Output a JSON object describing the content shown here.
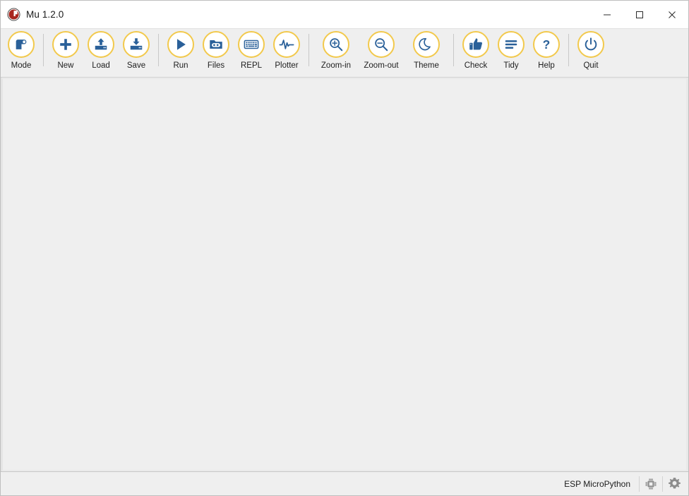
{
  "window": {
    "title": "Mu 1.2.0",
    "logo_icon": "mu-logo-icon",
    "controls": [
      {
        "name": "minimize",
        "icon": "minimize-icon",
        "label": "Minimize"
      },
      {
        "name": "maximize",
        "icon": "maximize-icon",
        "label": "Maximize"
      },
      {
        "name": "close",
        "icon": "close-icon",
        "label": "Close"
      }
    ]
  },
  "toolbar": {
    "items": [
      {
        "key": "mode",
        "label": "Mode",
        "icon": "mode-icon",
        "sep_after": true
      },
      {
        "key": "new",
        "label": "New",
        "icon": "new-icon",
        "sep_after": false
      },
      {
        "key": "load",
        "label": "Load",
        "icon": "load-icon",
        "sep_after": false
      },
      {
        "key": "save",
        "label": "Save",
        "icon": "save-icon",
        "sep_after": true
      },
      {
        "key": "run",
        "label": "Run",
        "icon": "run-icon",
        "sep_after": false
      },
      {
        "key": "files",
        "label": "Files",
        "icon": "files-icon",
        "sep_after": false
      },
      {
        "key": "repl",
        "label": "REPL",
        "icon": "repl-icon",
        "sep_after": false
      },
      {
        "key": "plotter",
        "label": "Plotter",
        "icon": "plotter-icon",
        "sep_after": true
      },
      {
        "key": "zoomin",
        "label": "Zoom-in",
        "icon": "zoom-in-icon",
        "sep_after": false
      },
      {
        "key": "zoomout",
        "label": "Zoom-out",
        "icon": "zoom-out-icon",
        "sep_after": false
      },
      {
        "key": "theme",
        "label": "Theme",
        "icon": "theme-moon-icon",
        "sep_after": true
      },
      {
        "key": "check",
        "label": "Check",
        "icon": "check-thumbsup-icon",
        "sep_after": false
      },
      {
        "key": "tidy",
        "label": "Tidy",
        "icon": "tidy-lines-icon",
        "sep_after": false
      },
      {
        "key": "help",
        "label": "Help",
        "icon": "help-question-icon",
        "sep_after": true
      },
      {
        "key": "quit",
        "label": "Quit",
        "icon": "quit-power-icon",
        "sep_after": false
      }
    ]
  },
  "editor": {
    "content": ""
  },
  "statusbar": {
    "mode_text": "ESP MicroPython",
    "chip_icon": "microchip-icon",
    "settings_icon": "gear-icon"
  },
  "colors": {
    "icon_ring": "#f2c94c",
    "icon_glyph": "#2a6099",
    "toolbar_bg": "#efefef",
    "editor_bg": "#efefef",
    "titlebar_bg": "#ffffff",
    "logo_red": "#a8271f",
    "status_icon_gray": "#8c8c8c"
  }
}
